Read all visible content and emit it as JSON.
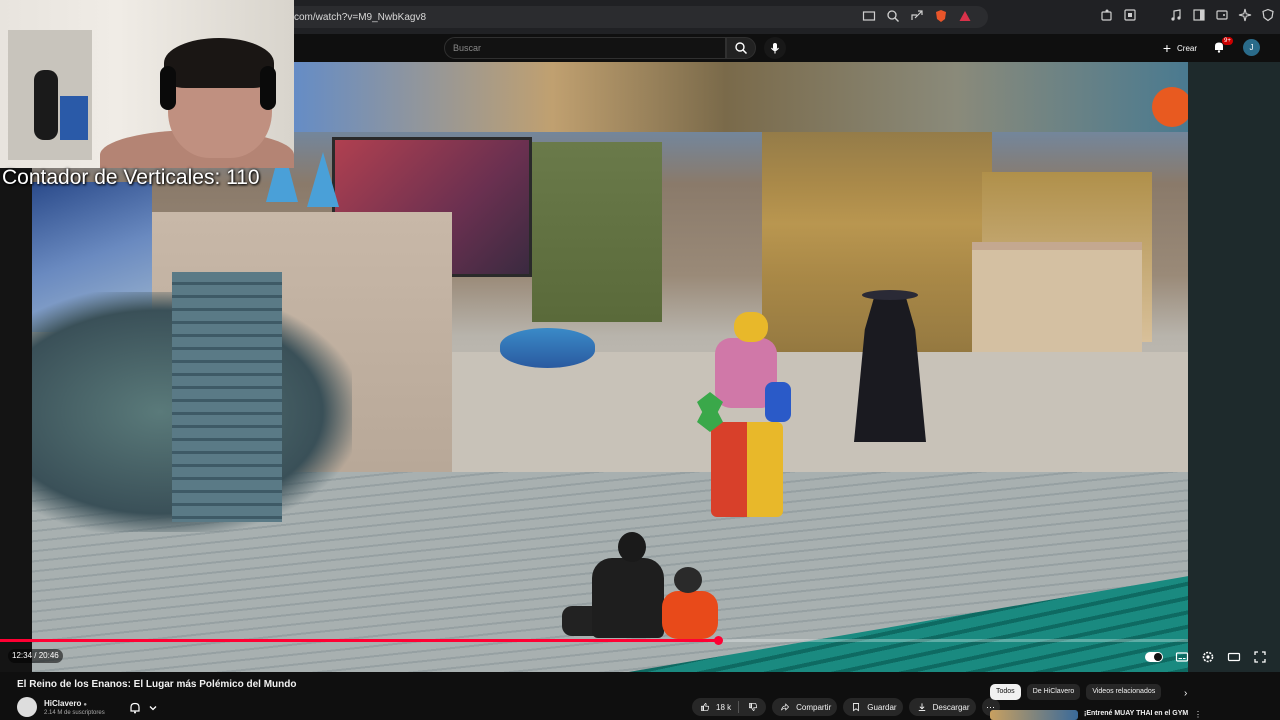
{
  "browser": {
    "url": "com/watch?v=M9_NwbKagv8"
  },
  "header": {
    "search_placeholder": "Buscar",
    "create_label": "Crear",
    "notifications_badge": "9+",
    "avatar_letter": "J"
  },
  "overlay": {
    "counter_text": "Contador de Verticales: 110"
  },
  "player": {
    "current_time": "12:34",
    "duration": "20:46",
    "progress_fraction": 0.6045,
    "accent_color": "#ff0033"
  },
  "video": {
    "title": "El Reino de los Enanos: El Lugar más Polémico del Mundo",
    "channel_name": "HiClavero",
    "subscribers": "2.14 M de suscriptores",
    "likes": "18 k",
    "share_label": "Compartir",
    "save_label": "Guardar",
    "download_label": "Descargar"
  },
  "recommendations": {
    "chips": [
      {
        "label": "Todos",
        "active": true
      },
      {
        "label": "De HiClavero",
        "active": false
      },
      {
        "label": "Videos relacionados",
        "active": false
      }
    ],
    "first_title": "¡Entrené MUAY THAI en el GYM"
  }
}
